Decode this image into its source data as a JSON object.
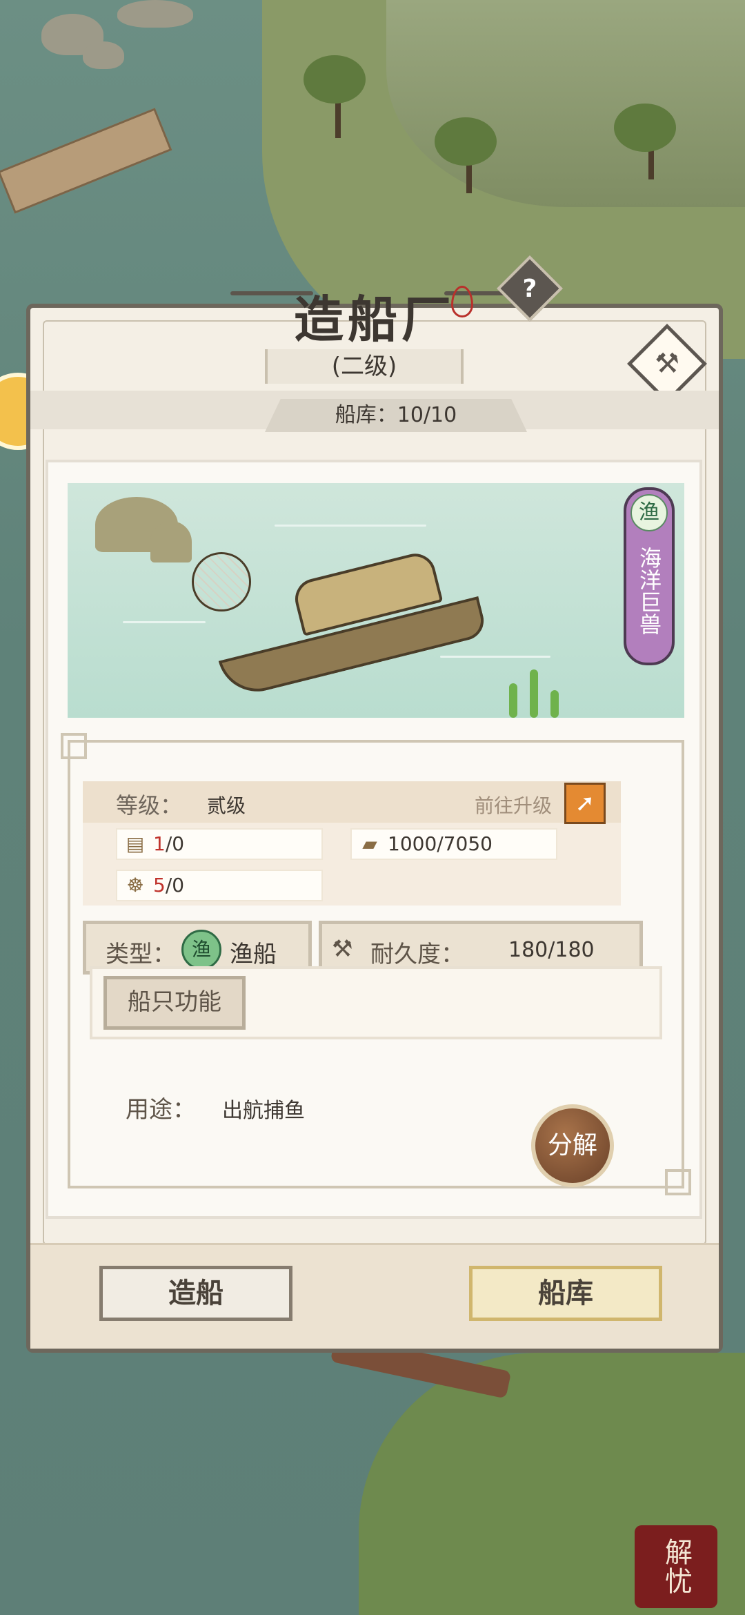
{
  "panel": {
    "title": "造船厂",
    "level": "(二级)",
    "help_glyph": "?",
    "storage": "船库：10/10"
  },
  "ship": {
    "category_tag_badge": "渔",
    "category_tag_text": "海洋巨兽",
    "level_label": "等级：",
    "level_value": "贰级",
    "upgrade_link": "前往升级",
    "resources": [
      {
        "icon": "map-icon",
        "current": "1",
        "rest": "/0"
      },
      {
        "icon": "wood-icon",
        "text": "1000/7050"
      },
      {
        "icon": "helm-icon",
        "current": "5",
        "rest": "/0"
      }
    ],
    "type_label": "类型：",
    "type_badge": "渔",
    "type_value": "渔船",
    "durability_label": "耐久度：",
    "durability_value": "180/180",
    "function_button": "船只功能",
    "usage_label": "用途：",
    "usage_value": "出航捕鱼",
    "dismantle_button": "分解"
  },
  "bottom": {
    "build_button": "造船",
    "shipyard_button": "船库"
  },
  "corner_seal": "解忧",
  "colors": {
    "tag_purple": "#b27fbd",
    "upgrade_orange": "#e48a32",
    "highlight_red": "#c0322b"
  }
}
